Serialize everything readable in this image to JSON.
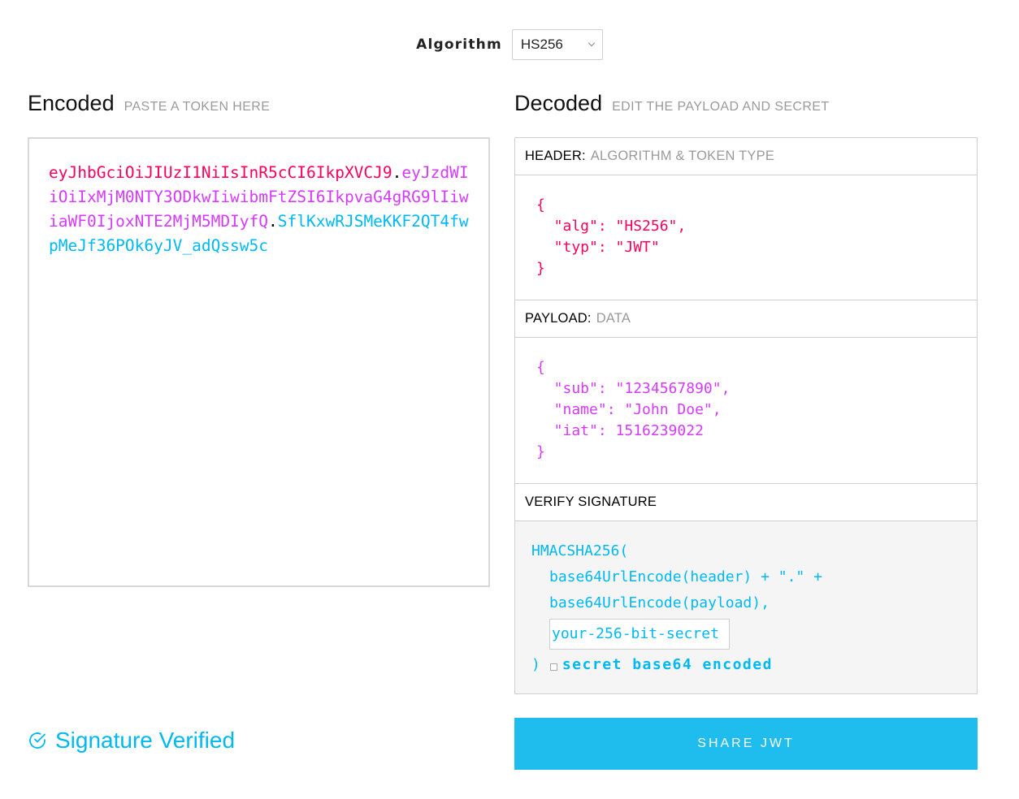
{
  "algorithm": {
    "label": "Algorithm",
    "selected": "HS256"
  },
  "encoded": {
    "title": "Encoded",
    "subtitle": "PASTE A TOKEN HERE",
    "token": {
      "header": "eyJhbGciOiJIUzI1NiIsInR5cCI6IkpXVCJ9",
      "payload": "eyJzdWIiOiIxMjM0NTY3ODkwIiwibmFtZSI6IkpvaG4gRG9lIiwiaWF0IjoxNTE2MjM5MDIyfQ",
      "signature": "SflKxwRJSMeKKF2QT4fwpMeJf36POk6yJV_adQssw5c",
      "dot": "."
    }
  },
  "decoded": {
    "title": "Decoded",
    "subtitle": "EDIT THE PAYLOAD AND SECRET",
    "header": {
      "label": "HEADER:",
      "sub": "ALGORITHM & TOKEN TYPE",
      "json": "{\n  \"alg\": \"HS256\",\n  \"typ\": \"JWT\"\n}"
    },
    "payload": {
      "label": "PAYLOAD:",
      "sub": "DATA",
      "json": "{\n  \"sub\": \"1234567890\",\n  \"name\": \"John Doe\",\n  \"iat\": 1516239022\n}"
    },
    "signature": {
      "label": "VERIFY SIGNATURE",
      "line1": "HMACSHA256(",
      "line2": "base64UrlEncode(header) + \".\" +",
      "line3": "base64UrlEncode(payload),",
      "secret_value": "your-256-bit-secret",
      "close": ")",
      "b64_label": "secret base64 encoded"
    }
  },
  "status": {
    "text": "Signature Verified",
    "color": "#00b9f1"
  },
  "share": {
    "label": "SHARE JWT"
  },
  "colors": {
    "header": "#fb015b",
    "payload": "#d63aff",
    "signature": "#00b9f1",
    "button": "#1fbcee"
  }
}
